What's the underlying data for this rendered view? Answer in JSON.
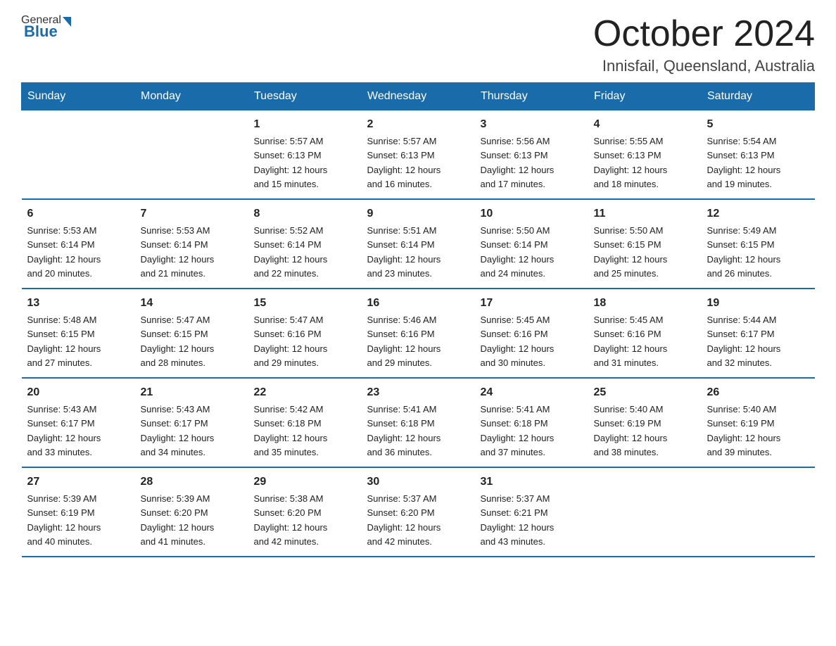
{
  "header": {
    "logo_general": "General",
    "logo_blue": "Blue",
    "title": "October 2024",
    "location": "Innisfail, Queensland, Australia"
  },
  "weekdays": [
    "Sunday",
    "Monday",
    "Tuesday",
    "Wednesday",
    "Thursday",
    "Friday",
    "Saturday"
  ],
  "weeks": [
    [
      {
        "day": "",
        "info": ""
      },
      {
        "day": "",
        "info": ""
      },
      {
        "day": "1",
        "info": "Sunrise: 5:57 AM\nSunset: 6:13 PM\nDaylight: 12 hours\nand 15 minutes."
      },
      {
        "day": "2",
        "info": "Sunrise: 5:57 AM\nSunset: 6:13 PM\nDaylight: 12 hours\nand 16 minutes."
      },
      {
        "day": "3",
        "info": "Sunrise: 5:56 AM\nSunset: 6:13 PM\nDaylight: 12 hours\nand 17 minutes."
      },
      {
        "day": "4",
        "info": "Sunrise: 5:55 AM\nSunset: 6:13 PM\nDaylight: 12 hours\nand 18 minutes."
      },
      {
        "day": "5",
        "info": "Sunrise: 5:54 AM\nSunset: 6:13 PM\nDaylight: 12 hours\nand 19 minutes."
      }
    ],
    [
      {
        "day": "6",
        "info": "Sunrise: 5:53 AM\nSunset: 6:14 PM\nDaylight: 12 hours\nand 20 minutes."
      },
      {
        "day": "7",
        "info": "Sunrise: 5:53 AM\nSunset: 6:14 PM\nDaylight: 12 hours\nand 21 minutes."
      },
      {
        "day": "8",
        "info": "Sunrise: 5:52 AM\nSunset: 6:14 PM\nDaylight: 12 hours\nand 22 minutes."
      },
      {
        "day": "9",
        "info": "Sunrise: 5:51 AM\nSunset: 6:14 PM\nDaylight: 12 hours\nand 23 minutes."
      },
      {
        "day": "10",
        "info": "Sunrise: 5:50 AM\nSunset: 6:14 PM\nDaylight: 12 hours\nand 24 minutes."
      },
      {
        "day": "11",
        "info": "Sunrise: 5:50 AM\nSunset: 6:15 PM\nDaylight: 12 hours\nand 25 minutes."
      },
      {
        "day": "12",
        "info": "Sunrise: 5:49 AM\nSunset: 6:15 PM\nDaylight: 12 hours\nand 26 minutes."
      }
    ],
    [
      {
        "day": "13",
        "info": "Sunrise: 5:48 AM\nSunset: 6:15 PM\nDaylight: 12 hours\nand 27 minutes."
      },
      {
        "day": "14",
        "info": "Sunrise: 5:47 AM\nSunset: 6:15 PM\nDaylight: 12 hours\nand 28 minutes."
      },
      {
        "day": "15",
        "info": "Sunrise: 5:47 AM\nSunset: 6:16 PM\nDaylight: 12 hours\nand 29 minutes."
      },
      {
        "day": "16",
        "info": "Sunrise: 5:46 AM\nSunset: 6:16 PM\nDaylight: 12 hours\nand 29 minutes."
      },
      {
        "day": "17",
        "info": "Sunrise: 5:45 AM\nSunset: 6:16 PM\nDaylight: 12 hours\nand 30 minutes."
      },
      {
        "day": "18",
        "info": "Sunrise: 5:45 AM\nSunset: 6:16 PM\nDaylight: 12 hours\nand 31 minutes."
      },
      {
        "day": "19",
        "info": "Sunrise: 5:44 AM\nSunset: 6:17 PM\nDaylight: 12 hours\nand 32 minutes."
      }
    ],
    [
      {
        "day": "20",
        "info": "Sunrise: 5:43 AM\nSunset: 6:17 PM\nDaylight: 12 hours\nand 33 minutes."
      },
      {
        "day": "21",
        "info": "Sunrise: 5:43 AM\nSunset: 6:17 PM\nDaylight: 12 hours\nand 34 minutes."
      },
      {
        "day": "22",
        "info": "Sunrise: 5:42 AM\nSunset: 6:18 PM\nDaylight: 12 hours\nand 35 minutes."
      },
      {
        "day": "23",
        "info": "Sunrise: 5:41 AM\nSunset: 6:18 PM\nDaylight: 12 hours\nand 36 minutes."
      },
      {
        "day": "24",
        "info": "Sunrise: 5:41 AM\nSunset: 6:18 PM\nDaylight: 12 hours\nand 37 minutes."
      },
      {
        "day": "25",
        "info": "Sunrise: 5:40 AM\nSunset: 6:19 PM\nDaylight: 12 hours\nand 38 minutes."
      },
      {
        "day": "26",
        "info": "Sunrise: 5:40 AM\nSunset: 6:19 PM\nDaylight: 12 hours\nand 39 minutes."
      }
    ],
    [
      {
        "day": "27",
        "info": "Sunrise: 5:39 AM\nSunset: 6:19 PM\nDaylight: 12 hours\nand 40 minutes."
      },
      {
        "day": "28",
        "info": "Sunrise: 5:39 AM\nSunset: 6:20 PM\nDaylight: 12 hours\nand 41 minutes."
      },
      {
        "day": "29",
        "info": "Sunrise: 5:38 AM\nSunset: 6:20 PM\nDaylight: 12 hours\nand 42 minutes."
      },
      {
        "day": "30",
        "info": "Sunrise: 5:37 AM\nSunset: 6:20 PM\nDaylight: 12 hours\nand 42 minutes."
      },
      {
        "day": "31",
        "info": "Sunrise: 5:37 AM\nSunset: 6:21 PM\nDaylight: 12 hours\nand 43 minutes."
      },
      {
        "day": "",
        "info": ""
      },
      {
        "day": "",
        "info": ""
      }
    ]
  ]
}
